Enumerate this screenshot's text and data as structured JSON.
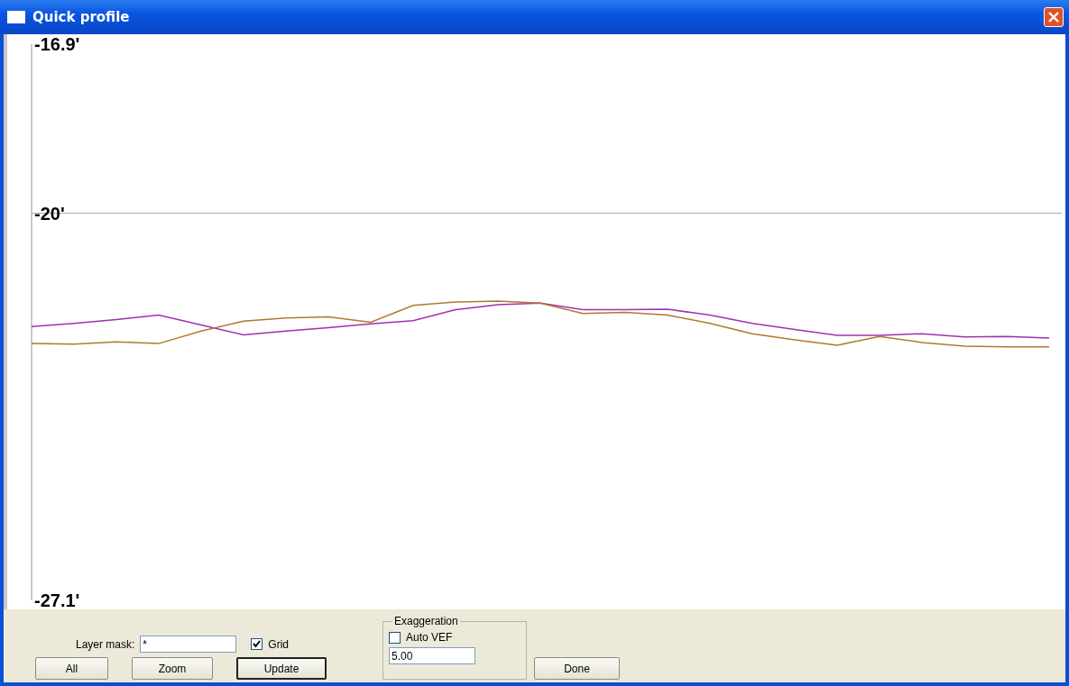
{
  "window": {
    "title": "Quick profile"
  },
  "profile": {
    "chart_data": {
      "type": "line",
      "ylim": [
        -27.1,
        -16.9
      ],
      "yticks": [
        {
          "value": -16.9,
          "label": "-16.9'"
        },
        {
          "value": -20,
          "label": "-20'"
        },
        {
          "value": -27.1,
          "label": "-27.1'"
        }
      ],
      "series": [
        {
          "color": "#a030b0",
          "values": [
            -22.08,
            -22.02,
            -21.95,
            -21.87,
            -22.05,
            -22.23,
            -22.16,
            -22.1,
            -22.03,
            -21.97,
            -21.77,
            -21.68,
            -21.65,
            -21.77,
            -21.77,
            -21.76,
            -21.87,
            -22.02,
            -22.13,
            -22.24,
            -22.24,
            -22.21,
            -22.27,
            -22.26,
            -22.29
          ]
        },
        {
          "color": "#b07830",
          "values": [
            -22.39,
            -22.4,
            -22.36,
            -22.39,
            -22.16,
            -21.98,
            -21.92,
            -21.9,
            -22.0,
            -21.69,
            -21.63,
            -21.61,
            -21.65,
            -21.84,
            -21.82,
            -21.87,
            -22.02,
            -22.21,
            -22.32,
            -22.42,
            -22.26,
            -22.37,
            -22.44,
            -22.45,
            -22.45
          ]
        }
      ]
    }
  },
  "controls": {
    "layer_mask": {
      "label": "Layer mask:",
      "value": "*"
    },
    "grid": {
      "label": "Grid",
      "checked": true
    },
    "exaggeration": {
      "title": "Exaggeration",
      "auto_vef": {
        "label": "Auto VEF",
        "checked": false
      },
      "value": "5.00"
    },
    "buttons": [
      {
        "label": "All",
        "default": false
      },
      {
        "label": "Zoom",
        "default": false
      },
      {
        "label": "Update",
        "default": true
      }
    ],
    "done": {
      "label": "Done",
      "default": false
    }
  }
}
